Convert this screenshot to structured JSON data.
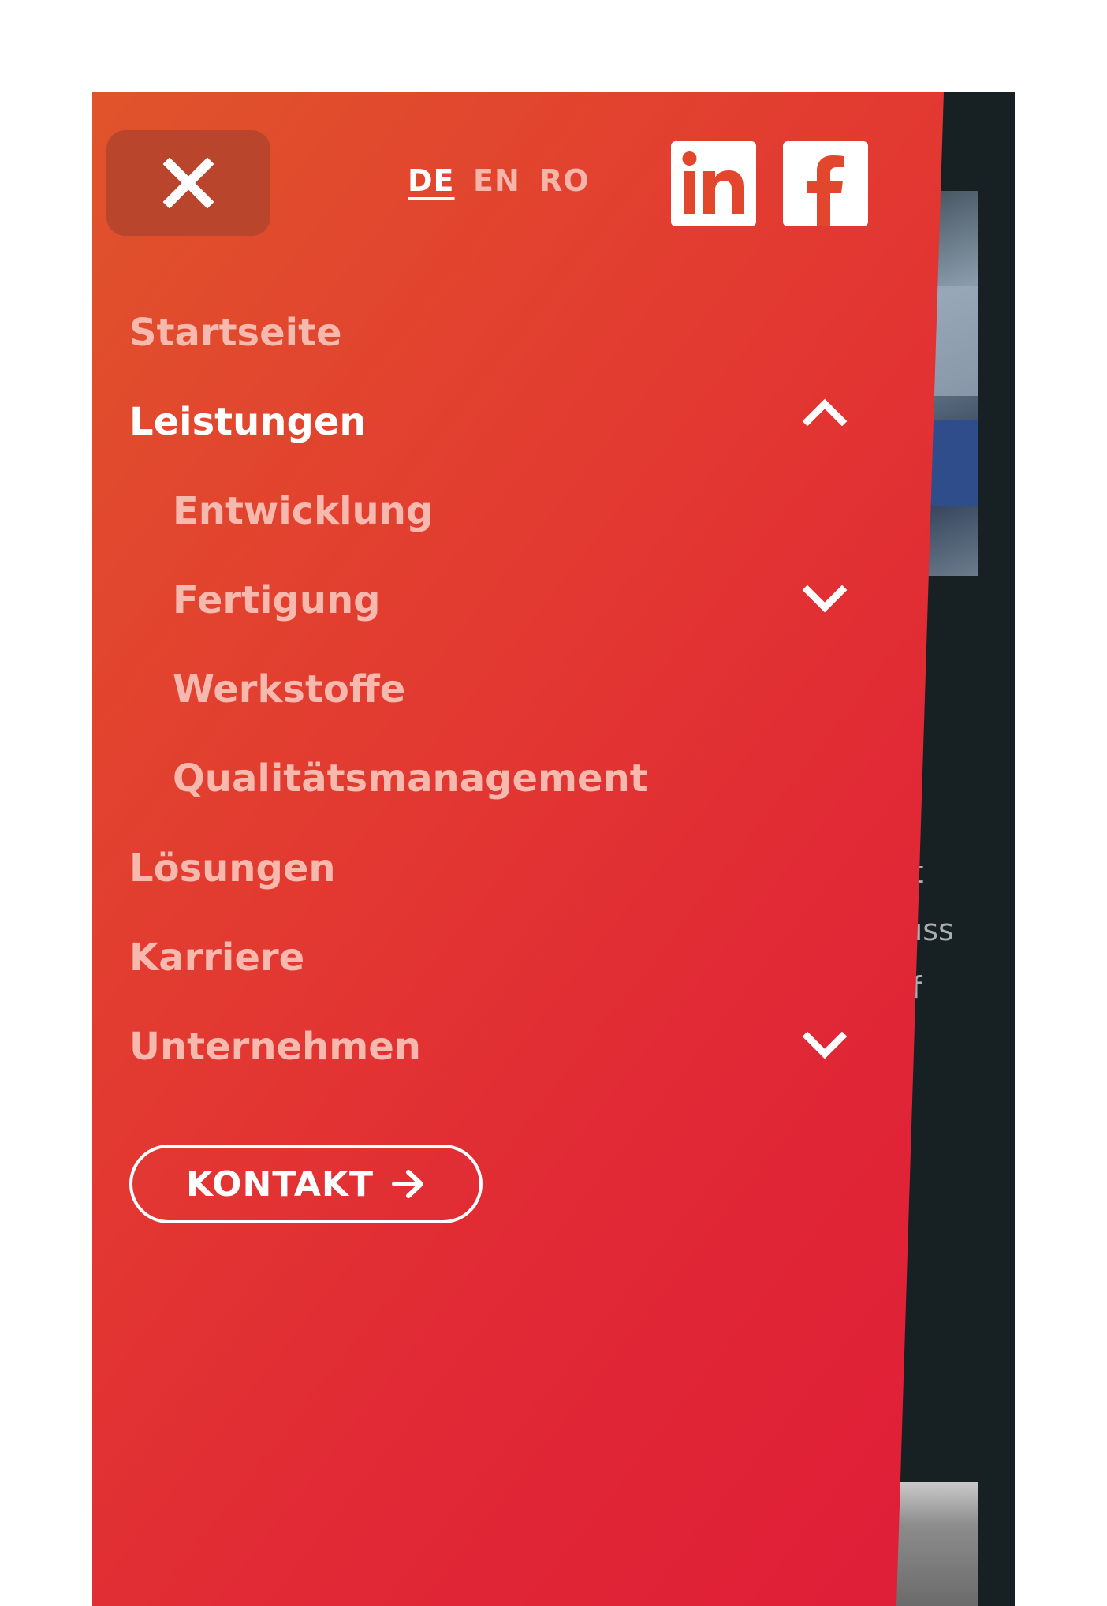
{
  "languages": [
    {
      "code": "DE",
      "active": true
    },
    {
      "code": "EN",
      "active": false
    },
    {
      "code": "RO",
      "active": false
    }
  ],
  "social": [
    {
      "icon": "linkedin-icon",
      "label": "in"
    },
    {
      "icon": "facebook-icon",
      "label": "f"
    }
  ],
  "nav": {
    "items": [
      {
        "label": "Startseite"
      },
      {
        "label": "Leistungen",
        "expanded": true
      },
      {
        "label": "Entwicklung"
      },
      {
        "label": "Fertigung",
        "expanded": false
      },
      {
        "label": "Werkstoffe"
      },
      {
        "label": "Qualitätsmanagement"
      },
      {
        "label": "Lösungen"
      },
      {
        "label": "Karriere"
      },
      {
        "label": "Unternehmen",
        "expanded": false
      }
    ]
  },
  "cta": {
    "label": "KONTAKT"
  },
  "background_text": {
    "line1": "nit",
    "line2": "guss",
    "line3": "liff"
  },
  "colors": {
    "drawer_start": "#e0542b",
    "drawer_end": "#df1d38",
    "close_button": "#b8452c",
    "nav_inactive": "#f7b8ae",
    "nav_active": "#ffffff",
    "page_background": "#172022"
  }
}
